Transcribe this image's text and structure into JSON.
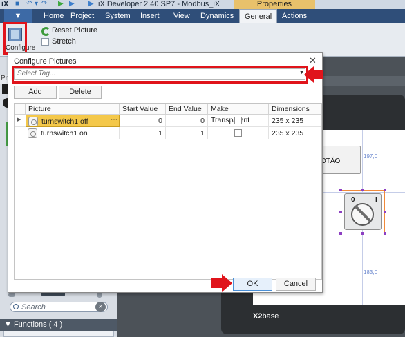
{
  "titlebar": {
    "logo": "iX",
    "title": "iX Developer 2.40 SP7 - Modbus_iX",
    "context_tab": "Properties"
  },
  "ribbon_tabs": [
    "Home",
    "Project",
    "System",
    "Insert",
    "View",
    "Dynamics",
    "General",
    "Actions"
  ],
  "active_tab": "General",
  "ribbon": {
    "configure_label": "Configure",
    "reset_picture": "Reset Picture",
    "stretch": "Stretch"
  },
  "left_panel": {
    "header_stub": "Pr",
    "search_placeholder": "Search",
    "functions": "Functions ( 4 )"
  },
  "canvas": {
    "button_text": "OTÃO",
    "coord_top": "197,0",
    "coord_bottom": "183,0",
    "switch_label_off": "0",
    "switch_label_on": "I",
    "screen_name_bold": "X2",
    "screen_name_suffix": "base"
  },
  "dialog": {
    "title": "Configure Pictures",
    "tag_placeholder": "Select Tag...",
    "add_label": "Add",
    "delete_label": "Delete",
    "columns": [
      "Picture",
      "Start Value",
      "End Value",
      "Make Transparent",
      "Dimensions"
    ],
    "rows": [
      {
        "picture": "turnswitch1 off",
        "start": "0",
        "end": "0",
        "transparent": false,
        "dimensions": "235 x 235",
        "selected": true
      },
      {
        "picture": "turnswitch1 on",
        "start": "1",
        "end": "1",
        "transparent": false,
        "dimensions": "235 x 235",
        "selected": false
      }
    ],
    "ok_label": "OK",
    "cancel_label": "Cancel"
  },
  "colors": {
    "highlight_red": "#e0141b",
    "ribbon_blue": "#2f4e79",
    "selected_cell": "#f4c84a"
  }
}
